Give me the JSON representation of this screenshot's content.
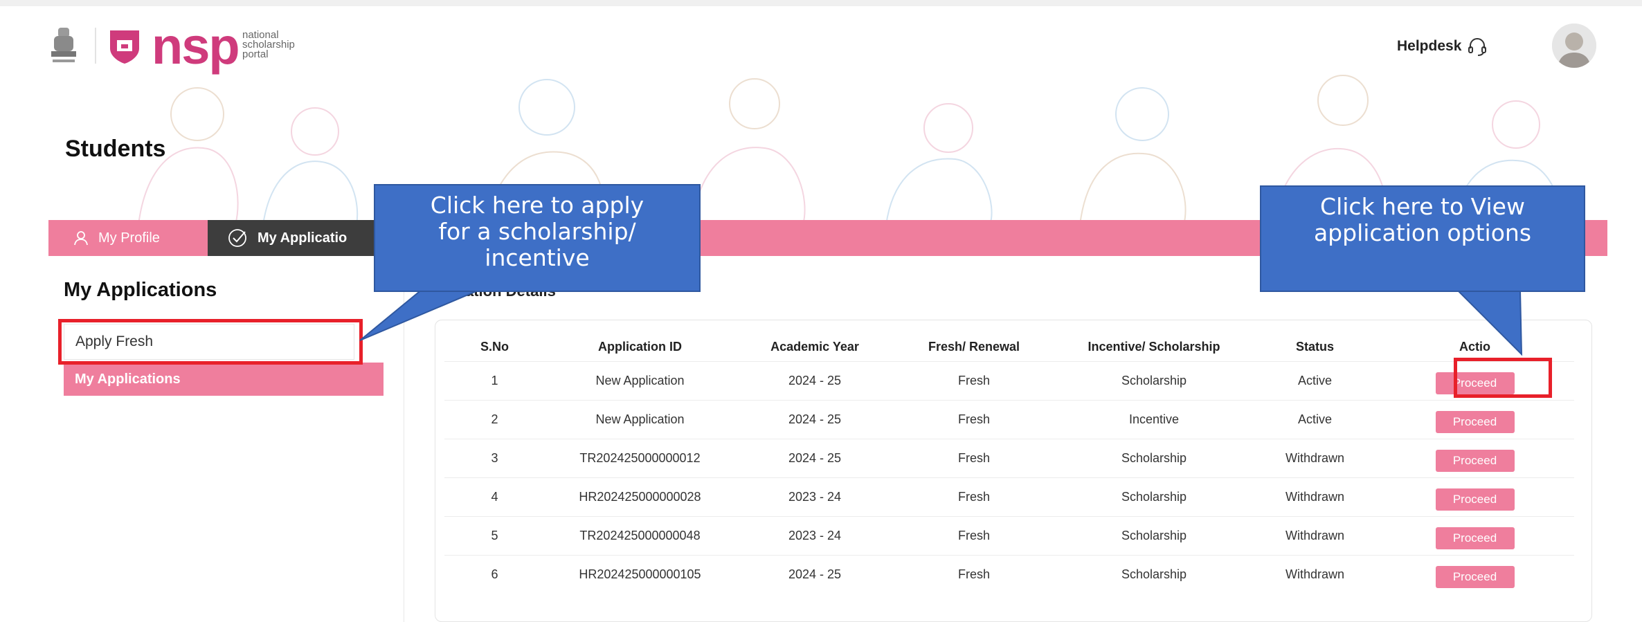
{
  "header": {
    "logo_main": "nsp",
    "logo_sub_lines": [
      "national",
      "scholarship",
      "portal"
    ],
    "helpdesk_label": "Helpdesk"
  },
  "page": {
    "title": "Students"
  },
  "tabs": [
    {
      "label": "My Profile",
      "icon": "user-icon"
    },
    {
      "label": "My Applicatio",
      "icon": "check-circle-icon",
      "active": true
    }
  ],
  "sidebar": {
    "heading": "My Applications",
    "items": [
      {
        "label": "Apply Fresh"
      },
      {
        "label": "My Applications",
        "active": true
      }
    ]
  },
  "main": {
    "section_title": "ation Details",
    "columns": [
      "S.No",
      "Application ID",
      "Academic Year",
      "Fresh/ Renewal",
      "Incentive/ Scholarship",
      "Status",
      "Actio"
    ],
    "rows": [
      {
        "sno": "1",
        "id": "New Application",
        "year": "2024 - 25",
        "type": "Fresh",
        "category": "Scholarship",
        "status": "Active",
        "action": "Proceed"
      },
      {
        "sno": "2",
        "id": "New Application",
        "year": "2024 - 25",
        "type": "Fresh",
        "category": "Incentive",
        "status": "Active",
        "action": "Proceed"
      },
      {
        "sno": "3",
        "id": "TR202425000000012",
        "year": "2024 - 25",
        "type": "Fresh",
        "category": "Scholarship",
        "status": "Withdrawn",
        "action": "Proceed"
      },
      {
        "sno": "4",
        "id": "HR202425000000028",
        "year": "2023 - 24",
        "type": "Fresh",
        "category": "Scholarship",
        "status": "Withdrawn",
        "action": "Proceed"
      },
      {
        "sno": "5",
        "id": "TR202425000000048",
        "year": "2023 - 24",
        "type": "Fresh",
        "category": "Scholarship",
        "status": "Withdrawn",
        "action": "Proceed"
      },
      {
        "sno": "6",
        "id": "HR202425000000105",
        "year": "2024 - 25",
        "type": "Fresh",
        "category": "Scholarship",
        "status": "Withdrawn",
        "action": "Proceed"
      }
    ]
  },
  "callouts": {
    "apply": [
      "Click here to apply",
      "for a scholarship/",
      "incentive"
    ],
    "view": [
      "Click here to View",
      "application options"
    ]
  },
  "colors": {
    "brand_pink": "#ef7e9d",
    "logo_pink": "#cf3b7c",
    "callout_blue": "#3e6fc6",
    "highlight_red": "#e8202a",
    "dark_tab": "#3d3d3d"
  }
}
